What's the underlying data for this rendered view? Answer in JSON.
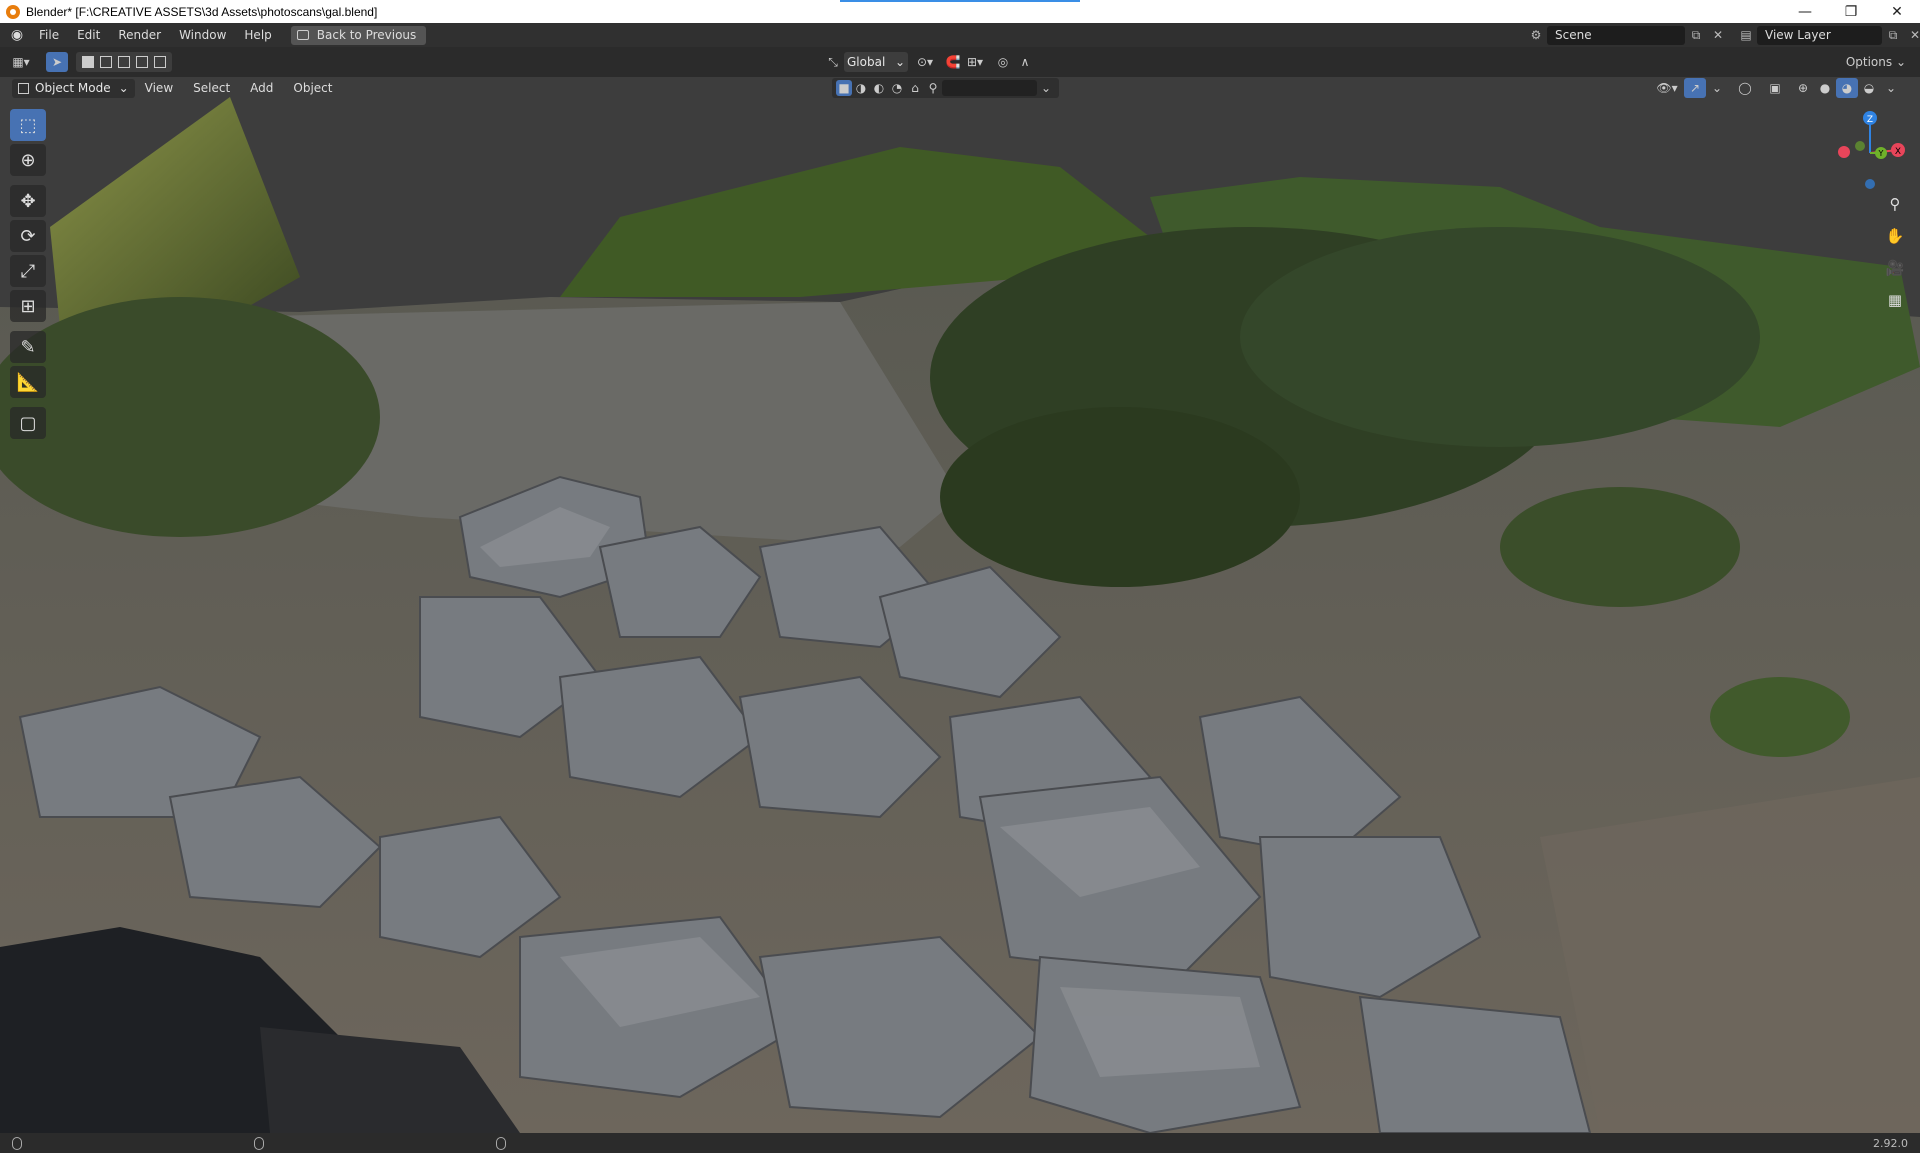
{
  "window": {
    "title": "Blender* [F:\\CREATIVE ASSETS\\3d Assets\\photoscans\\gal.blend]",
    "minimize": "—",
    "maximize": "❐",
    "close": "✕"
  },
  "menubar": {
    "items": [
      "File",
      "Edit",
      "Render",
      "Window",
      "Help"
    ],
    "back_button": "Back to Previous",
    "scene_label": "Scene",
    "view_layer_label": "View Layer"
  },
  "toolheader": {
    "orientation": "Global",
    "options": "Options"
  },
  "viewheader": {
    "mode": "Object Mode",
    "menus": [
      "View",
      "Select",
      "Add",
      "Object"
    ]
  },
  "gizmo": {
    "z": "Z",
    "y": "Y",
    "x": "X",
    "colors": {
      "x": "#e8455a",
      "y": "#6fb12a",
      "z": "#2f83e3"
    }
  },
  "status": {
    "version": "2.92.0"
  }
}
